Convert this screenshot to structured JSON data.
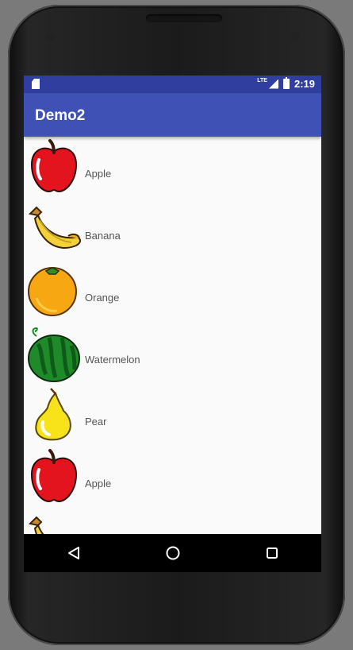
{
  "status_bar": {
    "network_label": "LTE",
    "time": "2:19"
  },
  "app_bar": {
    "title": "Demo2",
    "color": "#3f51b5",
    "status_color": "#303f9f"
  },
  "fruit_list": [
    {
      "name": "Apple",
      "icon": "apple-icon"
    },
    {
      "name": "Banana",
      "icon": "banana-icon"
    },
    {
      "name": "Orange",
      "icon": "orange-icon"
    },
    {
      "name": "Watermelon",
      "icon": "watermelon-icon"
    },
    {
      "name": "Pear",
      "icon": "pear-icon"
    },
    {
      "name": "Apple",
      "icon": "apple-icon"
    }
  ],
  "nav_bar": {
    "buttons": [
      "back-icon",
      "home-icon",
      "recents-icon"
    ]
  }
}
